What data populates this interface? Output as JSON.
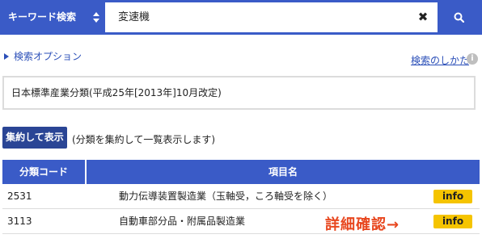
{
  "search": {
    "mode_label": "キーワード検索",
    "query": "変速機",
    "clear_glyph": "✖"
  },
  "options": {
    "label": "検索オプション",
    "howto_label": "検索のしかた",
    "help_glyph": "i"
  },
  "classification": {
    "text": "日本標準産業分類(平成25年[2013年]10月改定)"
  },
  "aggregate": {
    "button_label": "集約して表示",
    "note": "(分類を集約して一覧表示します)"
  },
  "table": {
    "headers": {
      "code": "分類コード",
      "name": "項目名"
    },
    "rows": [
      {
        "code": "2531",
        "name": "動力伝導装置製造業（玉軸受，ころ軸受を除く）",
        "info": "info"
      },
      {
        "code": "3113",
        "name": "自動車部分品・附属品製造業",
        "info": "info"
      }
    ]
  },
  "annotation": {
    "text": "詳細確認→"
  },
  "colors": {
    "primary": "#3a5bc7",
    "button_dark": "#2a4595",
    "info_yellow": "#f5c400",
    "annotation_red": "#e8471f"
  }
}
